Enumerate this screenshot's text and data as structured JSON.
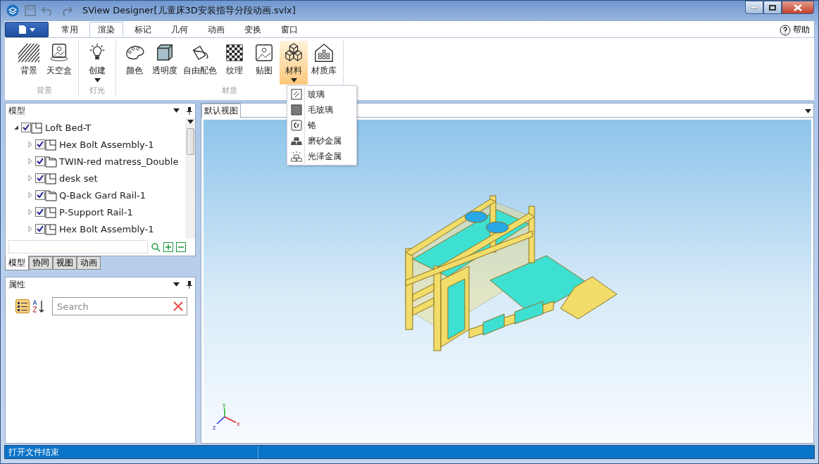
{
  "window": {
    "title": "SView Designer[儿童床3D安装指导分段动画.svlx]"
  },
  "ribbon": {
    "tabs": [
      {
        "label": "常用",
        "selected": false
      },
      {
        "label": "渲染",
        "selected": true
      },
      {
        "label": "标记",
        "selected": false
      },
      {
        "label": "几何",
        "selected": false
      },
      {
        "label": "动画",
        "selected": false
      },
      {
        "label": "变换",
        "selected": false
      },
      {
        "label": "窗口",
        "selected": false
      }
    ],
    "help": "帮助",
    "groups": [
      {
        "label": "背景",
        "items": [
          {
            "label": "背景",
            "kind": "hatch",
            "dropdown": false,
            "selected": false
          },
          {
            "label": "天空盒",
            "kind": "skybox",
            "dropdown": false,
            "selected": false
          }
        ]
      },
      {
        "label": "灯光",
        "items": [
          {
            "label": "创建",
            "kind": "bulb",
            "dropdown": true,
            "selected": false
          }
        ]
      },
      {
        "label": "材质",
        "items": [
          {
            "label": "颜色",
            "kind": "palette",
            "dropdown": false,
            "selected": false
          },
          {
            "label": "透明度",
            "kind": "cube",
            "dropdown": false,
            "selected": false
          },
          {
            "label": "自由配色",
            "kind": "bucket",
            "dropdown": false,
            "selected": false
          },
          {
            "label": "纹理",
            "kind": "checker",
            "dropdown": false,
            "selected": false
          },
          {
            "label": "贴图",
            "kind": "image",
            "dropdown": false,
            "selected": false
          },
          {
            "label": "材料",
            "kind": "cubes",
            "dropdown": true,
            "selected": true
          },
          {
            "label": "材质库",
            "kind": "library",
            "dropdown": false,
            "selected": false
          }
        ]
      }
    ]
  },
  "material_menu": [
    {
      "label": "玻璃",
      "kind": "glass"
    },
    {
      "label": "毛玻璃",
      "kind": "frosted"
    },
    {
      "label": "铬",
      "kind": "chrome"
    },
    {
      "label": "磨砂金属",
      "kind": "matte"
    },
    {
      "label": "光泽金属",
      "kind": "gloss"
    }
  ],
  "model_panel": {
    "title": "模型",
    "tree": [
      {
        "label": "Loft Bed-T",
        "checked": true,
        "expanded": true,
        "kind": "assembly",
        "children": [
          {
            "label": "Hex Bolt Assembly-1",
            "checked": true,
            "expanded": false,
            "kind": "assembly"
          },
          {
            "label": "TWIN-red matress_Double",
            "checked": true,
            "expanded": false,
            "kind": "folded"
          },
          {
            "label": "desk set",
            "checked": true,
            "expanded": false,
            "kind": "assembly"
          },
          {
            "label": "Q-Back Gard Rail-1",
            "checked": true,
            "expanded": false,
            "kind": "folded"
          },
          {
            "label": "P-Support Rail-1",
            "checked": true,
            "expanded": false,
            "kind": "assembly"
          },
          {
            "label": "Hex Bolt Assembly-1",
            "checked": true,
            "expanded": false,
            "kind": "assembly"
          }
        ]
      }
    ],
    "tabs": [
      {
        "label": "模型",
        "selected": true
      },
      {
        "label": "协同",
        "selected": false
      },
      {
        "label": "视图",
        "selected": false
      },
      {
        "label": "动画",
        "selected": false
      }
    ]
  },
  "properties_panel": {
    "title": "属性",
    "search": {
      "placeholder": "Search"
    }
  },
  "view": {
    "tab": "默认视图",
    "axis_labels": [
      "x",
      "y",
      "z"
    ]
  },
  "status_bar": {
    "text": "打开文件结束"
  }
}
